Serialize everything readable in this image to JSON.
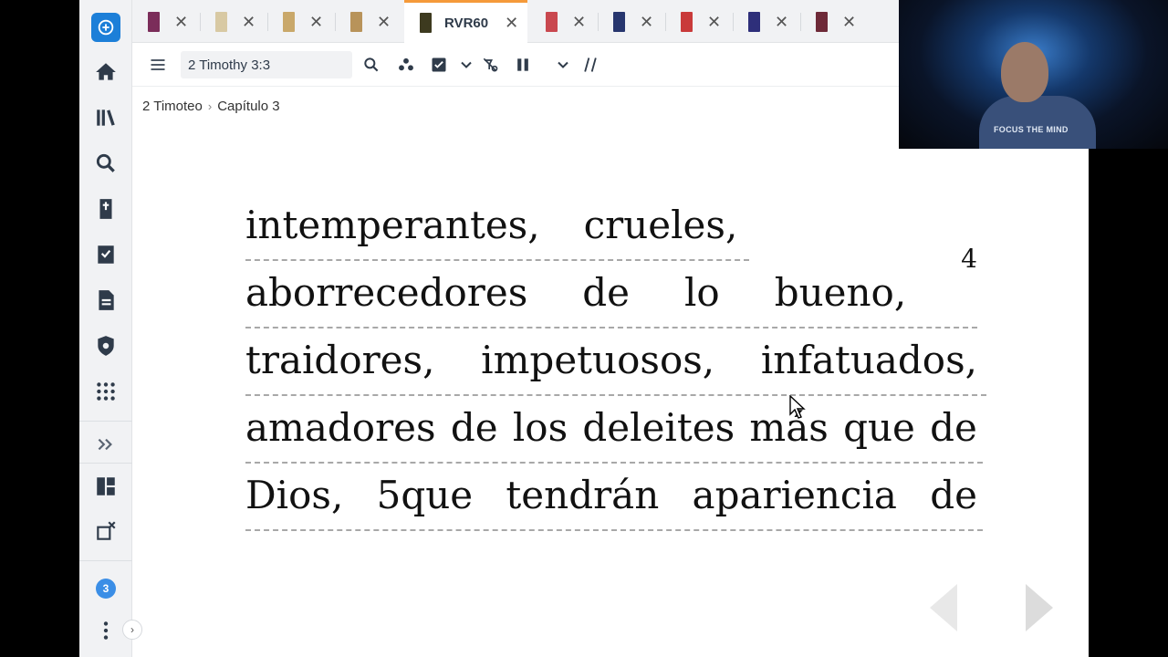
{
  "tabs": {
    "books": [
      {
        "color": "#7b2d5a"
      },
      {
        "color": "#d8c9a3"
      },
      {
        "color": "#c9a86a"
      },
      {
        "color": "#b8935a"
      }
    ],
    "active": {
      "label": "RVR60",
      "color": "#3d3a1f"
    },
    "books_after": [
      {
        "color": "#c9484f"
      },
      {
        "color": "#27366e"
      },
      {
        "color": "#c93a3a"
      },
      {
        "color": "#2e2f7a"
      },
      {
        "color": "#6e2a38"
      }
    ],
    "close_glyph": "✕"
  },
  "toolbar": {
    "reference_value": "2 Timothy 3:3"
  },
  "breadcrumb": {
    "book": "2 Timoteo",
    "separator": "›",
    "chapter": "Capítulo 3"
  },
  "reader": {
    "lines": [
      {
        "words": [
          "intemperantes,",
          "crueles,"
        ]
      },
      {
        "words": [
          "aborrecedores",
          "de",
          "lo",
          "bueno,",
          "4"
        ]
      },
      {
        "words": [
          "traidores,",
          "impetuosos,",
          "infatuados,"
        ]
      },
      {
        "words": [
          "amadores",
          "de",
          "los",
          "deleites",
          "más",
          "que",
          "de"
        ]
      },
      {
        "words": [
          "Dios,",
          "5que",
          "tendrán",
          "apariencia",
          "de"
        ]
      }
    ]
  },
  "rail": {
    "notification_count": "3"
  },
  "webcam": {
    "shirt_text": "FOCUS THE MIND"
  },
  "colors": {
    "accent_tab": "#f59a3a",
    "brand_blue": "#1c7fd8"
  }
}
